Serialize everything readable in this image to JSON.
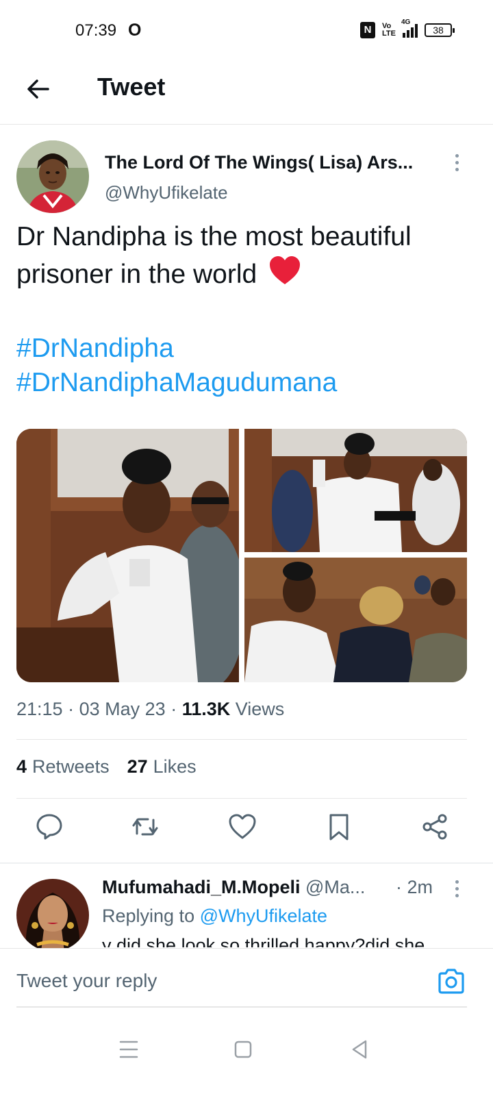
{
  "status_bar": {
    "time": "07:39",
    "network": "4G",
    "volte": "Vo LTE",
    "battery": "38"
  },
  "header": {
    "title": "Tweet",
    "back_icon": "arrow-left-icon"
  },
  "tweet": {
    "author_name": "The Lord Of The Wings( Lisa) Ars...",
    "author_handle": "@WhyUfikelate",
    "text": "Dr Nandipha is the most beautiful prisoner in the world",
    "emoji": "red-heart-icon",
    "hashtags": [
      "#DrNandipha",
      "#DrNandiphaMagudumana"
    ],
    "time": "21:15",
    "date": "03 May 23",
    "views_count": "11.3K",
    "views_label": "Views",
    "retweets_count": "4",
    "retweets_label": "Retweets",
    "likes_count": "27",
    "likes_label": "Likes",
    "actions": [
      "reply-icon",
      "retweet-icon",
      "like-icon",
      "bookmark-icon",
      "share-icon"
    ]
  },
  "reply": {
    "author_name": "Mufumahadi_M.Mopeli",
    "author_handle": "@Ma...",
    "time": "· 2m",
    "replying_prefix": "Replying to",
    "replying_to": "@WhyUfikelate",
    "text": "y did she look so thrilled happy?did she"
  },
  "reply_box": {
    "placeholder": "Tweet your reply"
  },
  "colors": {
    "accent": "#1d9bf0",
    "text": "#0f1419",
    "muted": "#536471",
    "heart": "#e8203a"
  }
}
